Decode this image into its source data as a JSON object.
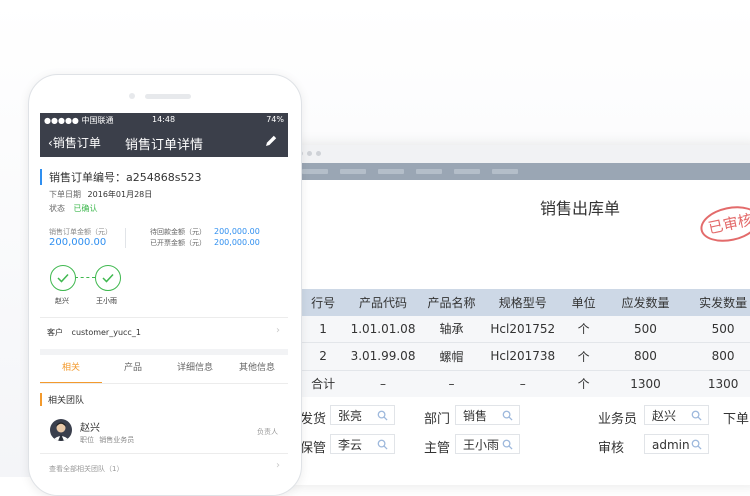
{
  "desktop": {
    "doc_title": "销售出库单",
    "stamp_text": "已审核",
    "columns": [
      "行号",
      "产品代码",
      "产品名称",
      "规格型号",
      "单位",
      "应发数量",
      "实发数量"
    ],
    "rows": [
      [
        "1",
        "1.01.01.08",
        "轴承",
        "Hcl201752",
        "个",
        "500",
        "500"
      ],
      [
        "2",
        "3.01.99.08",
        "螺帽",
        "Hcl201738",
        "个",
        "800",
        "800"
      ]
    ],
    "total_row": [
      "合计",
      "–",
      "–",
      "–",
      "个",
      "1300",
      "1300"
    ],
    "form": {
      "r1": [
        {
          "label": "发货",
          "value": "张亮"
        },
        {
          "label": "部门",
          "value": "销售"
        },
        {
          "label": "业务员",
          "value": "赵兴"
        },
        {
          "label": "下单",
          "value": ""
        }
      ],
      "r2": [
        {
          "label": "保管",
          "value": "李云"
        },
        {
          "label": "主管",
          "value": "王小雨"
        },
        {
          "label": "审核",
          "value": "admin"
        }
      ]
    }
  },
  "phone": {
    "status": {
      "carrier": "●●●●● 中国联通",
      "time": "14:48",
      "battery": "74%"
    },
    "nav": {
      "back": "销售订单",
      "title": "销售订单详情"
    },
    "order_no_label": "销售订单编号：a254868s523",
    "order_date_label": "下单日期",
    "order_date": "2016年01月28日",
    "state_label": "状态",
    "state": "已确认",
    "amount_label": "销售订单金额（元）",
    "amount": "200,000.00",
    "pending_label": "待回款金额（元）",
    "pending": "200,000.00",
    "invoiced_label": "已开票金额（元）",
    "invoiced": "200,000.00",
    "approvers": [
      "赵兴",
      "王小雨"
    ],
    "customer_label": "客户",
    "customer": "customer_yucc_1",
    "tabs": [
      "相关",
      "产品",
      "详细信息",
      "其他信息"
    ],
    "team_header": "相关团队",
    "member": {
      "name": "赵兴",
      "role_label": "职位",
      "role": "销售业务员",
      "badge": "负责人"
    },
    "view_all": "查看全部相关团队（1）"
  },
  "colors": {
    "accent_blue": "#2f8ff0",
    "ok_green": "#3fb84f",
    "tab_orange": "#f39a2d",
    "nav_dark": "#3b3f4a",
    "stamp_red": "#e36b6b"
  }
}
